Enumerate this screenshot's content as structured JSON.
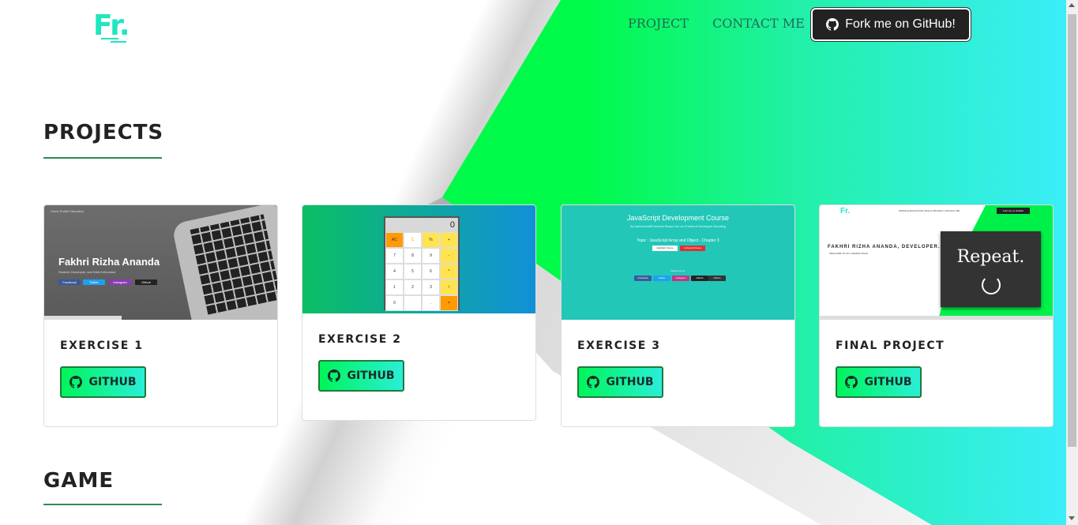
{
  "navbar": {
    "logo": "Fr.",
    "links": [
      "PROJECT",
      "CONTACT ME"
    ],
    "fork_button": "Fork me on GitHub!"
  },
  "sections": {
    "projects_title": "PROJECTS",
    "game_title": "GAME"
  },
  "projects": [
    {
      "title": "EXERCISE  1",
      "button": "GITHUB"
    },
    {
      "title": "EXERCISE  2",
      "button": "GITHUB"
    },
    {
      "title": "EXERCISE  3",
      "button": "GITHUB"
    },
    {
      "title": "FINAL  PROJECT",
      "button": "GITHUB"
    }
  ],
  "thumbs": {
    "t1": {
      "nav": "Home   Profile   Education",
      "name": "Fakhri Rizha Ananda",
      "sub": "Student, Developer, and Web Enthusiast",
      "buttons": [
        "Facebook",
        "Twitter",
        "Instagram",
        "Github"
      ]
    },
    "t2": {
      "display": "0",
      "keys": [
        "AC",
        "C",
        "%",
        "+",
        "7",
        "8",
        "9",
        "-",
        "4",
        "5",
        "6",
        "*",
        "1",
        "2",
        "3",
        "/",
        "0",
        "",
        ".",
        "="
      ]
    },
    "t3": {
      "heading": "JavaScript Development Course",
      "sub": "by fakhririzha96 learned  React,Vue  on  Frontend Developer  Dicoding",
      "topic": "Topic : JavaScript Array and Object - Chapter 3",
      "pills": [
        "Highlight Venue",
        "Unbound Venue"
      ],
      "follow": "Follow me on:",
      "social": [
        "Facebook",
        "Twitter",
        "Instagram",
        "Github",
        "Others"
      ]
    },
    "t4": {
      "logo": "Fr.",
      "nav": "PROFILE   EDUCATION   SKILLS   PROJECT   CONTACT ME",
      "fork": "Fork me on GitHub!",
      "header": "FAKHRI RIZHA ANANDA, DEVELOPER.",
      "welcome": "WELCOME TO MY LANDING PAGE",
      "slide": "Repeat."
    }
  },
  "colors": {
    "accent_green": "#00fa4a",
    "accent_cyan": "#3aeef8",
    "nav_text": "#1f6b55",
    "rule": "#2e8b57"
  }
}
